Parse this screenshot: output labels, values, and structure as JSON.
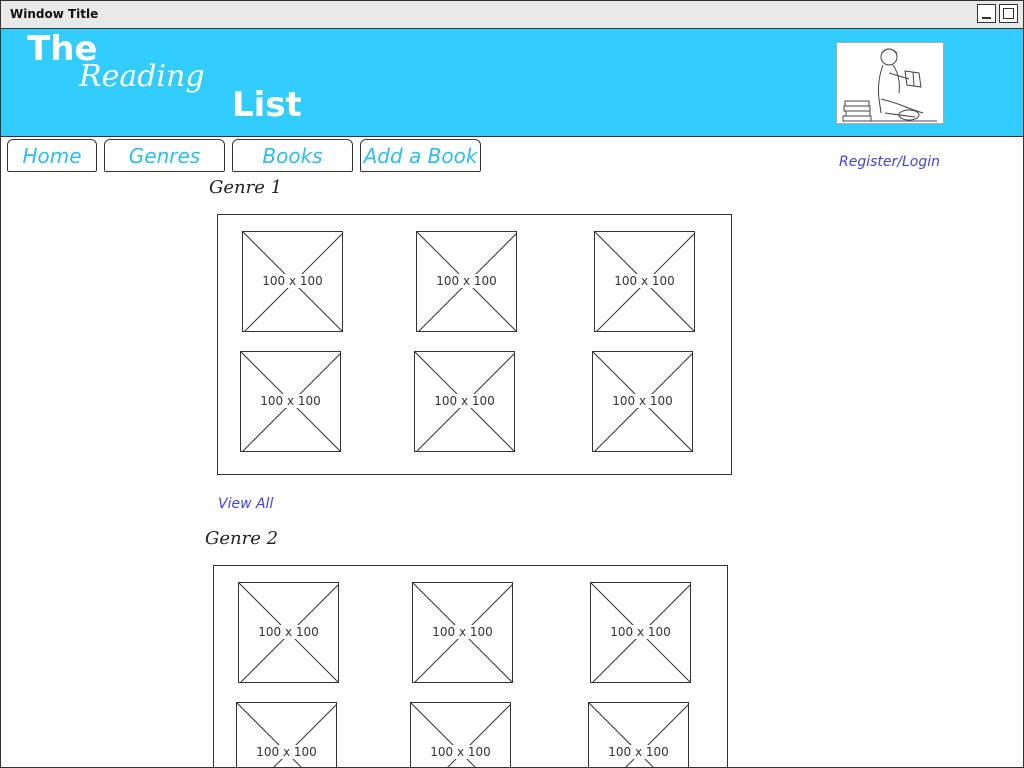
{
  "window": {
    "title": "Window Title"
  },
  "header": {
    "logo_the": "The",
    "logo_reading": "Reading",
    "logo_list": "List",
    "image_icon": "reading-child-illustration",
    "background_color": "#33ccff"
  },
  "nav": {
    "tabs": [
      {
        "label": "Home"
      },
      {
        "label": "Genres"
      },
      {
        "label": "Books"
      },
      {
        "label": "Add a Book"
      }
    ],
    "register_login": "Register/Login"
  },
  "genres": [
    {
      "heading": "Genre 1",
      "books": [
        {
          "label": "100 x 100"
        },
        {
          "label": "100 x 100"
        },
        {
          "label": "100 x 100"
        },
        {
          "label": "100 x 100"
        },
        {
          "label": "100 x 100"
        },
        {
          "label": "100 x 100"
        }
      ],
      "view_all": "View All"
    },
    {
      "heading": "Genre 2",
      "books": [
        {
          "label": "100 x 100"
        },
        {
          "label": "100 x 100"
        },
        {
          "label": "100 x 100"
        },
        {
          "label": "100 x 100"
        },
        {
          "label": "100 x 100"
        },
        {
          "label": "100 x 100"
        }
      ]
    }
  ]
}
